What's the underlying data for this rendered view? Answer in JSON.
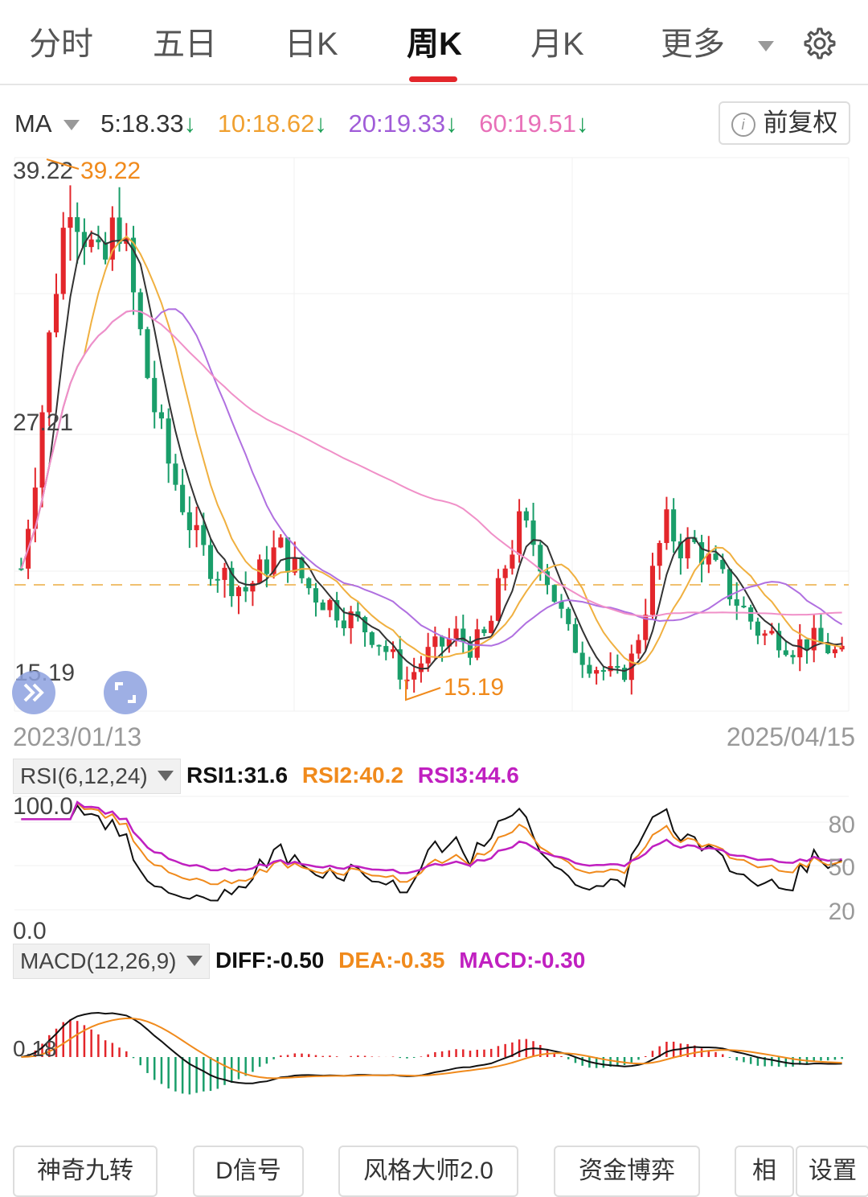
{
  "tabs": [
    {
      "label": "分时",
      "x": 36
    },
    {
      "label": "五日",
      "x": 190
    },
    {
      "label": "日K",
      "x": 354
    },
    {
      "label": "周K",
      "x": 506,
      "active": true
    },
    {
      "label": "月K",
      "x": 660
    },
    {
      "label": "更多",
      "x": 822
    }
  ],
  "ma_bar": {
    "label": "MA",
    "items": [
      {
        "text": "5:18.33",
        "color": "#333333"
      },
      {
        "text": "10:18.62",
        "color": "#f0a030"
      },
      {
        "text": "20:19.33",
        "color": "#a05cd8"
      },
      {
        "text": "60:19.51",
        "color": "#e870b8"
      }
    ],
    "arrow": "↓",
    "adjust_button": "前复权"
  },
  "price_chart": {
    "high_label": "39.22",
    "high_marker": "39.22",
    "mid_label": "27.21",
    "low_label": "15.19",
    "low_marker": "15.19",
    "start_date": "2023/01/13",
    "end_date": "2025/04/15"
  },
  "rsi_panel": {
    "label": "RSI(6,12,24)",
    "values": [
      {
        "text": "RSI1:31.6",
        "color": "#111111"
      },
      {
        "text": "RSI2:40.2",
        "color": "#f08a1c"
      },
      {
        "text": "RSI3:44.6",
        "color": "#c020c0"
      }
    ],
    "axis_left_top": "100.0",
    "axis_left_bottom": "0.0",
    "axis_right": [
      "80",
      "50",
      "20"
    ]
  },
  "macd_panel": {
    "label": "MACD(12,26,9)",
    "values": [
      {
        "text": "DIFF:-0.50",
        "color": "#111111"
      },
      {
        "text": "DEA:-0.35",
        "color": "#f08a1c"
      },
      {
        "text": "MACD:-0.30",
        "color": "#c020c0"
      }
    ],
    "axis_label": "0.18"
  },
  "bottom_buttons": [
    {
      "label": "神奇九转"
    },
    {
      "label": "D信号"
    },
    {
      "label": "风格大师2.0"
    },
    {
      "label": "资金博弈"
    },
    {
      "label": "相"
    },
    {
      "label": "设置"
    }
  ],
  "colors": {
    "up": "#e3262b",
    "down": "#1a9e6a",
    "ma5": "#333333",
    "ma10": "#f0b040",
    "ma20": "#b070e0",
    "ma60": "#f090c8",
    "rsi1": "#111111",
    "rsi2": "#f08a1c",
    "rsi3": "#c020c0",
    "diff": "#111111",
    "dea": "#f08a1c"
  },
  "chart_data": {
    "type": "candlestick",
    "title": "",
    "xlabel": "",
    "ylabel": "",
    "date_range": [
      "2023/01/13",
      "2025/04/15"
    ],
    "ylim": [
      15.19,
      39.22
    ],
    "series_guide": [
      {
        "name": "MA5",
        "value": 18.33
      },
      {
        "name": "MA10",
        "value": 18.62
      },
      {
        "name": "MA20",
        "value": 19.33
      },
      {
        "name": "MA60",
        "value": 19.51
      }
    ],
    "close_trend": [
      21,
      26,
      33,
      38,
      36,
      34,
      37,
      33,
      29,
      26,
      24,
      22,
      21,
      20.5,
      20,
      21,
      22,
      21,
      20,
      19.5,
      19,
      18.5,
      18,
      17,
      16,
      17,
      17.5,
      18,
      17.5,
      18,
      21,
      23,
      22,
      20,
      18,
      17,
      16.5,
      16,
      17,
      20,
      23,
      22,
      22,
      21,
      20,
      19,
      18,
      18,
      17.5,
      17.8,
      17.5,
      17
    ],
    "rsi": {
      "rsi1_last": 31.6,
      "rsi2_last": 40.2,
      "rsi3_last": 44.6,
      "ylim": [
        0,
        100
      ]
    },
    "macd": {
      "diff_last": -0.5,
      "dea_last": -0.35,
      "macd_last": -0.3
    }
  }
}
